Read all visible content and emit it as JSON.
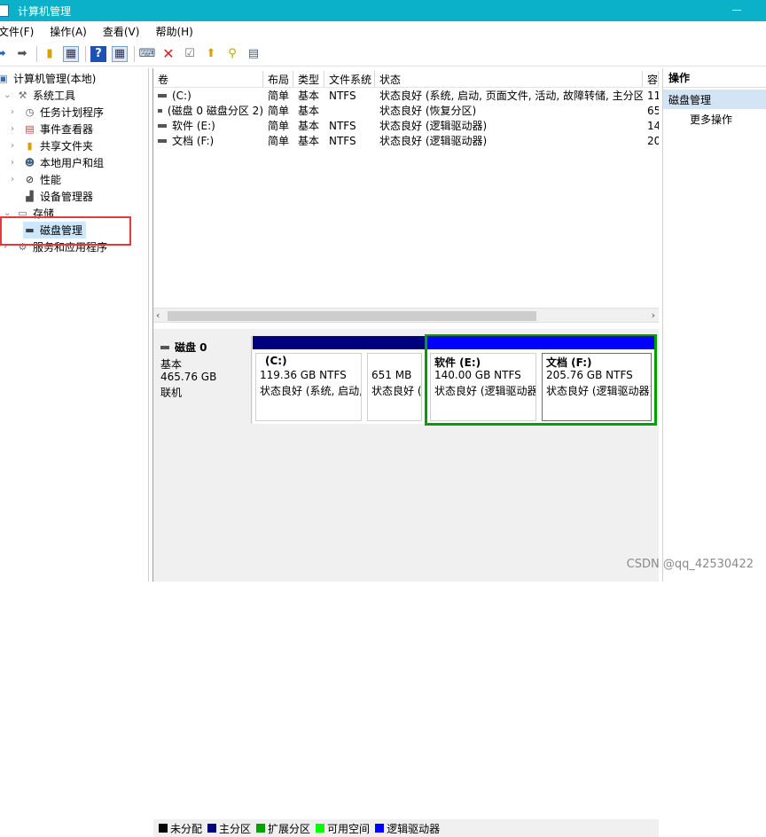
{
  "window": {
    "title": "计算机管理"
  },
  "menu": [
    "文件(F)",
    "操作(A)",
    "查看(V)",
    "帮助(H)"
  ],
  "toolbar": [
    "back-icon",
    "forward-icon",
    "folder-up-icon",
    "console-tree-icon",
    "help-icon",
    "show-hide-icon",
    "connect-icon",
    "delete-icon",
    "properties-icon",
    "import-icon",
    "search-icon",
    "list-icon"
  ],
  "tree": {
    "root": "计算机管理(本地)",
    "system_tools": "系统工具",
    "items": [
      "任务计划程序",
      "事件查看器",
      "共享文件夹",
      "本地用户和组",
      "性能",
      "设备管理器"
    ],
    "storage": "存储",
    "disk_mgmt": "磁盘管理",
    "services": "服务和应用程序"
  },
  "volumes": {
    "headers": [
      "卷",
      "布局",
      "类型",
      "文件系统",
      "状态",
      "容"
    ],
    "rows": [
      [
        "(C:)",
        "简单",
        "基本",
        "NTFS",
        "状态良好 (系统, 启动, 页面文件, 活动, 故障转储, 主分区)",
        "11"
      ],
      [
        "(磁盘 0 磁盘分区 2)",
        "简单",
        "基本",
        "",
        "状态良好 (恢复分区)",
        "65"
      ],
      [
        "软件 (E:)",
        "简单",
        "基本",
        "NTFS",
        "状态良好 (逻辑驱动器)",
        "14"
      ],
      [
        "文档 (F:)",
        "简单",
        "基本",
        "NTFS",
        "状态良好 (逻辑驱动器)",
        "20"
      ]
    ]
  },
  "disk": {
    "name": "磁盘 0",
    "type": "基本",
    "size": "465.76 GB",
    "status": "联机",
    "partitions": [
      {
        "label": "(C:)",
        "size": "119.36 GB NTFS",
        "status": "状态良好 (系统, 启动,"
      },
      {
        "label": "",
        "size": "651 MB",
        "status": "状态良好 ("
      },
      {
        "label": "软件  (E:)",
        "size": "140.00 GB NTFS",
        "status": "状态良好 (逻辑驱动器"
      },
      {
        "label": "文档  (F:)",
        "size": "205.76 GB NTFS",
        "status": "状态良好 (逻辑驱动器)"
      }
    ]
  },
  "legend": [
    {
      "label": "未分配",
      "color": "#000000"
    },
    {
      "label": "主分区",
      "color": "#00007f"
    },
    {
      "label": "扩展分区",
      "color": "#00a000"
    },
    {
      "label": "可用空间",
      "color": "#00ff00"
    },
    {
      "label": "逻辑驱动器",
      "color": "#0000ff"
    }
  ],
  "actions": {
    "header": "操作",
    "selected": "磁盘管理",
    "more": "更多操作"
  },
  "watermark": "CSDN @qq_42530422"
}
